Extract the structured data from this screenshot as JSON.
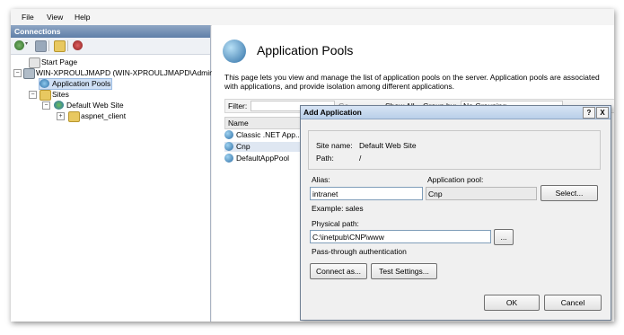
{
  "menu": {
    "file": "File",
    "view": "View",
    "help": "Help"
  },
  "connections": {
    "header": "Connections",
    "tree": {
      "start_page": "Start Page",
      "server": "WIN-XPROULJMAPD (WIN-XPROULJMAPD\\Adminis",
      "app_pools": "Application Pools",
      "sites": "Sites",
      "default_site": "Default Web Site",
      "aspnet_client": "aspnet_client"
    }
  },
  "content": {
    "title": "Application Pools",
    "description": "This page lets you view and manage the list of application pools on the server. Application pools are associated with applications, and provide isolation among different applications.",
    "filter_label": "Filter:",
    "go_label": "Go",
    "show_all_label": "Show All",
    "group_by_label": "Group by:",
    "group_by_value": "No Grouping",
    "column_name": "Name",
    "pools": [
      "Classic .NET App...",
      "Cnp",
      "DefaultAppPool"
    ]
  },
  "dialog": {
    "title": "Add Application",
    "help_btn": "?",
    "close_btn": "X",
    "site_name_label": "Site name:",
    "site_name_value": "Default Web Site",
    "path_label": "Path:",
    "path_value": "/",
    "alias_label": "Alias:",
    "alias_value": "intranet",
    "app_pool_label": "Application pool:",
    "app_pool_value": "Cnp",
    "select_btn": "Select...",
    "example": "Example: sales",
    "physical_path_label": "Physical path:",
    "physical_path_value": "C:\\inetpub\\CNP\\www",
    "browse_btn": "...",
    "passthrough": "Pass-through authentication",
    "connect_as_btn": "Connect as...",
    "test_settings_btn": "Test Settings...",
    "ok_btn": "OK",
    "cancel_btn": "Cancel"
  }
}
